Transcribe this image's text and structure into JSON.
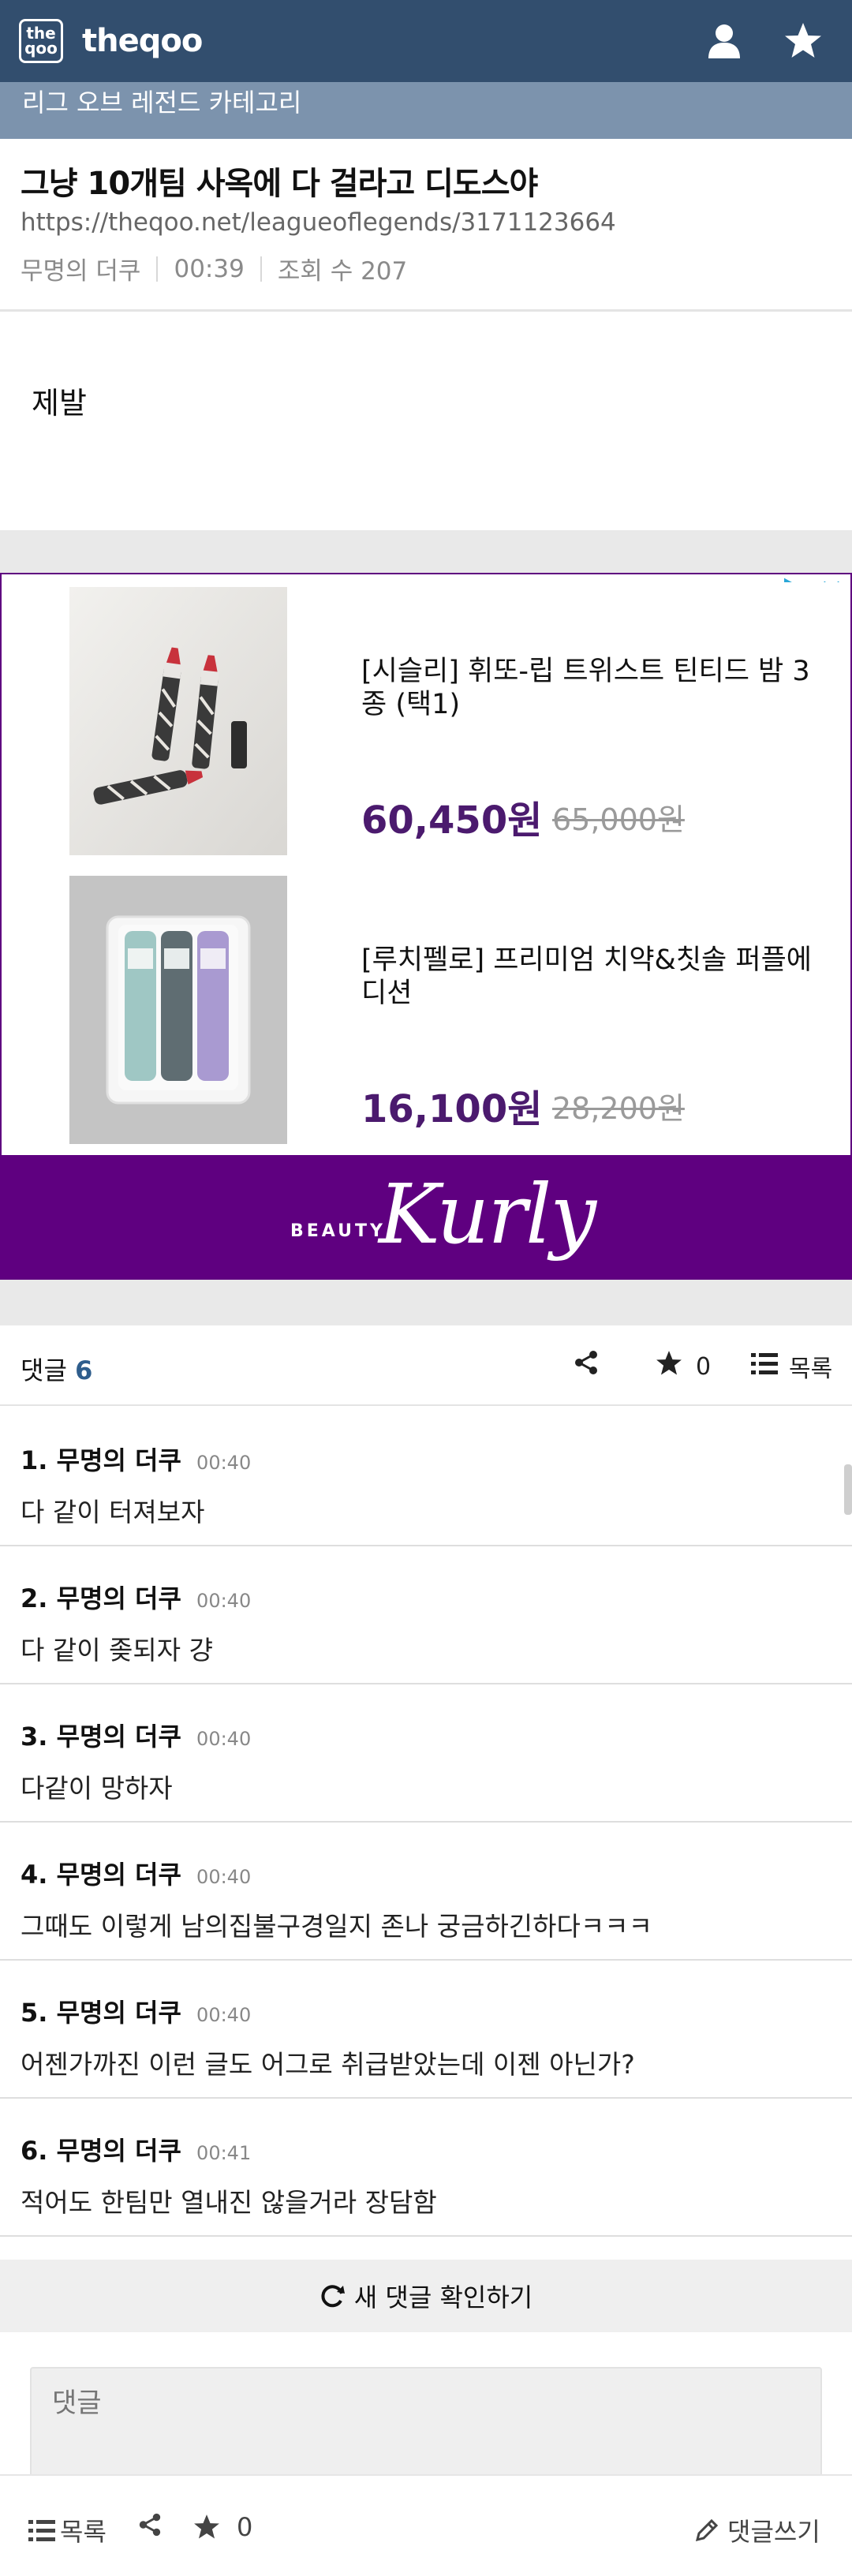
{
  "header": {
    "logo_text_top": "the",
    "logo_text_bottom": "qoo",
    "brand": "theqoo",
    "icons": [
      "user-icon",
      "star-icon"
    ],
    "bg_color": "#324e6e"
  },
  "category": "리그 오브 레전드 카테고리",
  "post": {
    "title": "그냥 10개팀 사옥에 다 걸라고 디도스야",
    "url": "https://theqoo.net/leagueoflegends/3171123664",
    "author": "무명의 더쿠",
    "time": "00:39",
    "views": "조회 수 207",
    "body": "제발"
  },
  "ad": {
    "items": [
      {
        "name": "[시슬리] 휘또-립 트위스트 틴티드 밤 3종 (택1)",
        "price": "60,450원",
        "original_price": "65,000원"
      },
      {
        "name": "[루치펠로] 프리미엄 치약&칫솔 퍼플에디션",
        "price": "16,100원",
        "original_price": "28,200원"
      }
    ],
    "banner_small": "BEAUTY",
    "banner_big": "Kurly",
    "accent_color": "#5f0080"
  },
  "comments_bar": {
    "label": "댓글",
    "count": "6",
    "star_count": "0",
    "list_label": "목록"
  },
  "comments": [
    {
      "num": "1.",
      "author": "무명의 더쿠",
      "time": "00:40",
      "text": "다 같이 터져보자"
    },
    {
      "num": "2.",
      "author": "무명의 더쿠",
      "time": "00:40",
      "text": "다 같이 좆되자 걍"
    },
    {
      "num": "3.",
      "author": "무명의 더쿠",
      "time": "00:40",
      "text": "다같이 망하자"
    },
    {
      "num": "4.",
      "author": "무명의 더쿠",
      "time": "00:40",
      "text": "그때도 이렇게 남의집불구경일지 존나 궁금하긴하다ㅋㅋㅋ"
    },
    {
      "num": "5.",
      "author": "무명의 더쿠",
      "time": "00:40",
      "text": "어젠가까진 이런 글도 어그로 취급받았는데 이젠 아닌가?"
    },
    {
      "num": "6.",
      "author": "무명의 더쿠",
      "time": "00:41",
      "text": "적어도 한팀만 열내진 않을거라 장담함"
    }
  ],
  "new_comment_check": "새 댓글 확인하기",
  "comment_input": {
    "placeholder": "댓글"
  },
  "bottom_bar": {
    "list_label": "목록",
    "star_count": "0",
    "write_label": "댓글쓰기"
  }
}
